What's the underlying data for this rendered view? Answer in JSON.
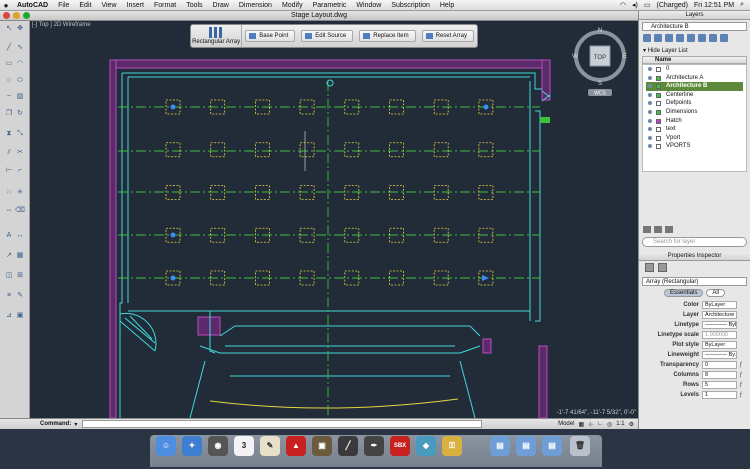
{
  "menubar": {
    "items": [
      "AutoCAD",
      "File",
      "Edit",
      "View",
      "Insert",
      "Format",
      "Tools",
      "Draw",
      "Dimension",
      "Modify",
      "Parametric",
      "Window",
      "Subscription",
      "Help"
    ],
    "battery": "(Charged)",
    "clock": "Fri 12:51 PM"
  },
  "window": {
    "title": "Stage Layout.dwg"
  },
  "viewport": {
    "label": "[-] Top ] 2D Wireframe"
  },
  "context_bar": {
    "big_button": "Rectangular Array",
    "buttons": [
      "Base Point",
      "Edit Source",
      "Replace Item",
      "Reset Array"
    ]
  },
  "navcube": {
    "face": "TOP",
    "north": "N",
    "south": "S",
    "east": "E",
    "west": "W",
    "wcs": "WCS"
  },
  "coords": "-1'-7 41/64\", -11'-7 5/32\", 0'-0\"",
  "command": {
    "label": "Command:",
    "value": ""
  },
  "status": {
    "model_tab": "Model",
    "scale": "1:1"
  },
  "layers": {
    "title": "Layers",
    "current": "Architecture B",
    "hide_list": "Hide Layer List",
    "col_name": "Name",
    "rows": [
      {
        "name": "0",
        "color": "#ffffff"
      },
      {
        "name": "Architecture A",
        "color": "#3fbf3f"
      },
      {
        "name": "Architecture B",
        "color": "#3fbf3f"
      },
      {
        "name": "Centerline",
        "color": "#3fbf3f"
      },
      {
        "name": "Defpoints",
        "color": "#ffffff"
      },
      {
        "name": "Dimensions",
        "color": "#3fbf3f"
      },
      {
        "name": "Hatch",
        "color": "#c03fc0"
      },
      {
        "name": "text",
        "color": "#ffffff"
      },
      {
        "name": "Vport",
        "color": "#ffffff"
      },
      {
        "name": "VPORTS",
        "color": "#ffffff"
      }
    ],
    "search_placeholder": "Search for layer"
  },
  "properties": {
    "title": "Properties Inspector",
    "object_type": "Array (Rectangular)",
    "tab_essentials": "Essentials",
    "tab_all": "All",
    "rows": [
      {
        "key": "Color",
        "value": "ByLayer"
      },
      {
        "key": "Layer",
        "value": "Architecture B"
      },
      {
        "key": "Linetype",
        "value": "———— ByL"
      },
      {
        "key": "Linetype scale",
        "value": "1.000000"
      },
      {
        "key": "Plot style",
        "value": "ByLayer"
      },
      {
        "key": "Lineweight",
        "value": "———— By..."
      },
      {
        "key": "Transparency",
        "value": "0"
      },
      {
        "key": "Columns",
        "value": "8"
      },
      {
        "key": "Rows",
        "value": "5"
      },
      {
        "key": "Levels",
        "value": "1"
      }
    ]
  },
  "dock": {
    "icons": [
      "finder-icon",
      "safari-icon",
      "photo-booth-icon",
      "calendar-icon",
      "textedit-icon",
      "acrobat-icon",
      "preview-icon",
      "wacom-icon",
      "pen-icon",
      "sbx-icon",
      "app-icon",
      "keychain-icon",
      "folder-icon",
      "folder-icon",
      "folder-icon",
      "trash-icon"
    ],
    "calendar_day": "3",
    "sbx_label": "SBX"
  }
}
